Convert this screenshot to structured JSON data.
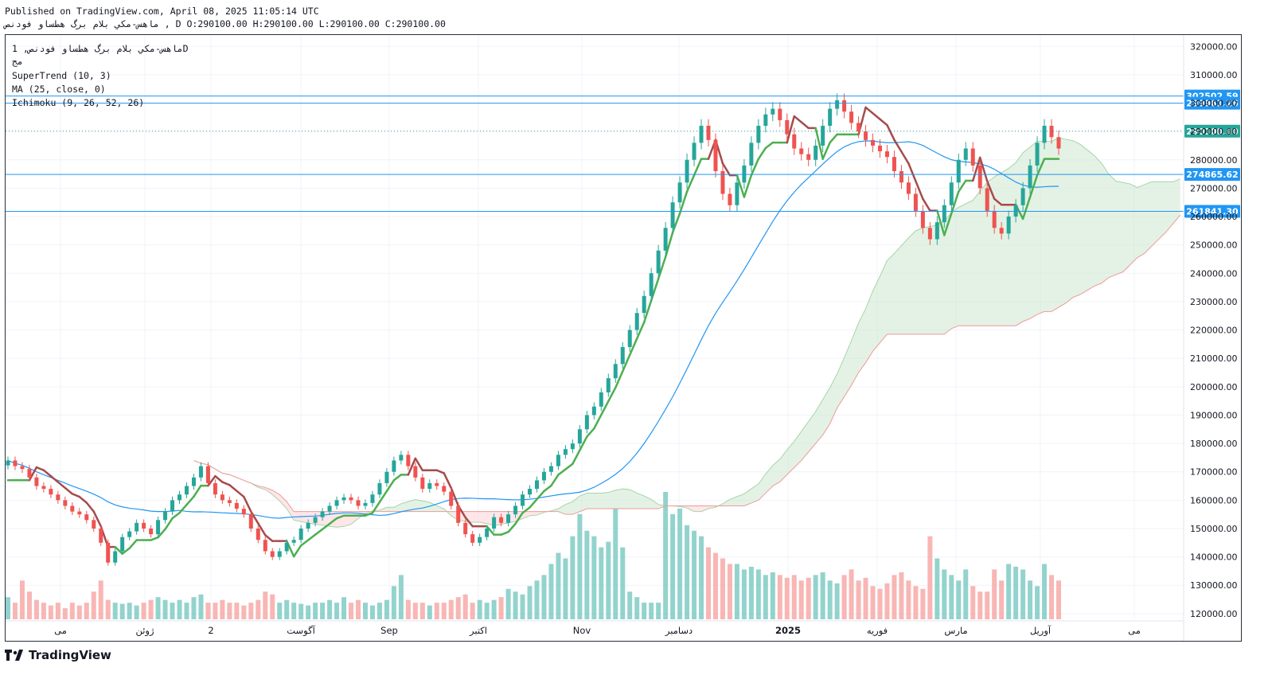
{
  "header": {
    "published": "Published on TradingView.com, April 08, 2025 11:05:14 UTC",
    "ohlc_line": "ماهس-مكي بلام برگ هطساو فودنص , D O:290100.00 H:290100.00 L:290100.00 C:290100.00"
  },
  "legend": {
    "symbol": "ماهس-مكي بلام برگ هطساو فودنص, 1D",
    "exchange": "مج",
    "supertrend": "SuperTrend (10, 3)",
    "ma": "MA (25, close, 0)",
    "ichimoku": "Ichimoku (9, 26, 52, 26)"
  },
  "colors": {
    "up": "#26a69a",
    "down": "#ef5350",
    "supertrend_up": "#4caf50",
    "supertrend_down": "#a64b4b",
    "ma": "#2196f3",
    "cloud_bull": "#c8e6c9",
    "cloud_bear": "#ffcdd2",
    "hline": "#2196f3",
    "price_badge": "#26a69a"
  },
  "chart_data": {
    "type": "candlestick",
    "ylim": [
      118000,
      324000
    ],
    "y_ticks": [
      "320000.00",
      "310000.00",
      "300000.00",
      "290000.00",
      "280000.00",
      "270000.00",
      "260000.00",
      "250000.00",
      "240000.00",
      "230000.00",
      "220000.00",
      "210000.00",
      "200000.00",
      "190000.00",
      "180000.00",
      "170000.00",
      "160000.00",
      "150000.00",
      "140000.00",
      "130000.00",
      "120000.00"
    ],
    "x_labels": [
      "می",
      "ژوئن",
      "2",
      "آگوست",
      "Sep",
      "اکتبر",
      "Nov",
      "دسامبر",
      "2025",
      "فوریه",
      "مارس",
      "آوریل",
      "می"
    ],
    "horizontal_levels": [
      {
        "value": 302502.59,
        "label": "302502.59"
      },
      {
        "value": 299961.26,
        "label": "299961.26"
      },
      {
        "value": 274865.62,
        "label": "274865.62"
      },
      {
        "value": 261841.3,
        "label": "261841.30"
      }
    ],
    "last_price": {
      "value": 290100.0,
      "label": "290100.00"
    },
    "candles_close": [
      174000,
      172000,
      171000,
      168000,
      165000,
      164000,
      162000,
      160000,
      158000,
      156000,
      155000,
      153000,
      150000,
      145000,
      138000,
      142000,
      147000,
      149000,
      152000,
      150000,
      148000,
      153000,
      156000,
      160000,
      162000,
      165000,
      168000,
      172000,
      166000,
      162000,
      160000,
      159000,
      157000,
      155000,
      150000,
      146000,
      142000,
      140000,
      142000,
      145000,
      146000,
      150000,
      152000,
      154000,
      156000,
      158000,
      160000,
      161000,
      160000,
      158000,
      159000,
      162000,
      166000,
      170000,
      174000,
      176000,
      172000,
      168000,
      164000,
      166000,
      165000,
      163000,
      158000,
      152000,
      148000,
      145000,
      147000,
      150000,
      154000,
      152000,
      155000,
      158000,
      162000,
      164000,
      167000,
      170000,
      172000,
      176000,
      178000,
      180000,
      185000,
      190000,
      193000,
      198000,
      203000,
      208000,
      214000,
      220000,
      226000,
      232000,
      240000,
      248000,
      256000,
      265000,
      272000,
      280000,
      286000,
      292000,
      287000,
      276000,
      268000,
      264000,
      272000,
      278000,
      286000,
      292000,
      296000,
      298000,
      294000,
      289000,
      284000,
      282000,
      280000,
      285000,
      292000,
      298000,
      301000,
      297000,
      293000,
      290000,
      287000,
      285000,
      283000,
      281000,
      276000,
      272000,
      268000,
      262000,
      256000,
      252000,
      258000,
      264000,
      272000,
      280000,
      284000,
      278000,
      270000,
      262000,
      256000,
      254000,
      260000,
      264000,
      270000,
      278000,
      286000,
      292000,
      288000,
      284000
    ],
    "volume_relative": [
      0.4,
      0.3,
      0.7,
      0.5,
      0.35,
      0.3,
      0.25,
      0.3,
      0.2,
      0.3,
      0.25,
      0.3,
      0.5,
      0.7,
      0.35,
      0.3,
      0.28,
      0.3,
      0.25,
      0.3,
      0.35,
      0.4,
      0.35,
      0.3,
      0.35,
      0.3,
      0.4,
      0.45,
      0.3,
      0.3,
      0.35,
      0.3,
      0.3,
      0.25,
      0.3,
      0.35,
      0.5,
      0.45,
      0.3,
      0.35,
      0.3,
      0.28,
      0.25,
      0.3,
      0.3,
      0.35,
      0.3,
      0.4,
      0.3,
      0.35,
      0.3,
      0.25,
      0.3,
      0.35,
      0.6,
      0.8,
      0.35,
      0.3,
      0.3,
      0.25,
      0.3,
      0.3,
      0.35,
      0.4,
      0.45,
      0.3,
      0.35,
      0.3,
      0.35,
      0.4,
      0.55,
      0.5,
      0.45,
      0.6,
      0.7,
      0.8,
      1.0,
      1.2,
      1.1,
      1.5,
      1.9,
      1.6,
      1.5,
      1.3,
      1.4,
      2.0,
      1.3,
      0.5,
      0.4,
      0.3,
      0.3,
      0.3,
      2.3,
      1.9,
      2.0,
      1.7,
      1.6,
      1.5,
      1.3,
      1.2,
      1.1,
      1.0,
      1.0,
      0.9,
      0.95,
      0.9,
      0.8,
      0.85,
      0.8,
      0.75,
      0.8,
      0.7,
      0.75,
      0.8,
      0.85,
      0.7,
      0.65,
      0.8,
      0.9,
      0.7,
      0.75,
      0.6,
      0.55,
      0.65,
      0.8,
      0.85,
      0.7,
      0.6,
      0.55,
      1.5,
      1.1,
      0.9,
      0.8,
      0.7,
      0.9,
      0.6,
      0.5,
      0.5,
      0.9,
      0.7,
      1.0,
      0.95,
      0.9,
      0.7,
      0.6,
      1.0,
      0.8,
      0.7
    ]
  }
}
